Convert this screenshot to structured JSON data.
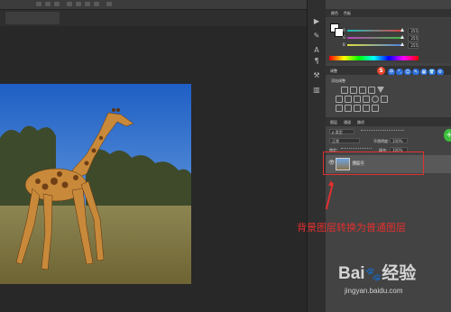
{
  "color_panel": {
    "tabs": [
      "颜色",
      "色板"
    ],
    "sliders": [
      {
        "label": "R",
        "value": "255",
        "color": "#e04040"
      },
      {
        "label": "G",
        "value": "255",
        "color": "#3fbf3f"
      },
      {
        "label": "B",
        "value": "255",
        "color": "#4a7ee0"
      }
    ]
  },
  "adjust_panel": {
    "tab": "调整",
    "subtitle": "添加调整"
  },
  "sogou_bar": {
    "logo": "S",
    "items": [
      "中",
      "°,",
      "☺",
      "✎",
      "▦",
      "👕",
      "⚙"
    ]
  },
  "layers_panel": {
    "tabs": [
      "图层",
      "通道",
      "路径"
    ],
    "filter_label": "ρ 类型",
    "blend_mode": "正常",
    "opacity_label": "不透明度:",
    "opacity_value": "100%",
    "lock_label": "锁定:",
    "fill_label": "填充:",
    "fill_value": "100%",
    "layer_name": "图层 0"
  },
  "annotation": "背景图层转换为普通图层",
  "watermark": {
    "brand": "Bai",
    "brand2": "经验",
    "url": "jingyan.baidu.com"
  }
}
